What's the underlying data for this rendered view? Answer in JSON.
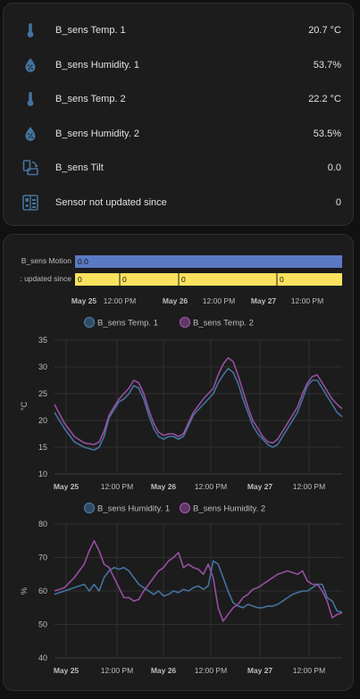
{
  "colors": {
    "background": "#111111",
    "card": "#1c1c1c",
    "icon": "#44739e",
    "series_blue": "#44739e",
    "series_purple": "#984ea3",
    "timeline_motion": "#5b7ac4",
    "timeline_updated": "#fbe25e"
  },
  "entities": [
    {
      "icon": "thermometer-icon",
      "label": "B_sens Temp. 1",
      "value": "20.7 °C"
    },
    {
      "icon": "water-percent-icon",
      "label": "B_sens Humidity. 1",
      "value": "53.7%"
    },
    {
      "icon": "thermometer-icon",
      "label": "B_sens Temp. 2",
      "value": "22.2 °C"
    },
    {
      "icon": "water-percent-icon",
      "label": "B_sens Humidity. 2",
      "value": "53.5%"
    },
    {
      "icon": "phone-rotate-icon",
      "label": "B_sens Tilt",
      "value": "0.0"
    },
    {
      "icon": "motion-sensor-icon",
      "label": "Sensor not updated since",
      "value": "0"
    }
  ],
  "timeline": {
    "rows": [
      {
        "label": "B_sens Motion",
        "segments": [
          "0.0"
        ]
      },
      {
        "label": ": updated since",
        "segments": [
          "0",
          "0",
          "0",
          "0"
        ]
      }
    ],
    "x_ticks": [
      "May 25",
      "12:00 PM",
      "May 26",
      "12:00 PM",
      "May 27",
      "12:00 PM"
    ]
  },
  "chart_data": [
    {
      "type": "line",
      "legend": [
        "B_sens Temp. 1",
        "B_sens Temp. 2"
      ],
      "ylabel": "°C",
      "ylim": [
        10,
        35
      ],
      "yticks": [
        10,
        15,
        20,
        25,
        30,
        35
      ],
      "x_ticks": [
        "May 25",
        "12:00 PM",
        "May 26",
        "12:00 PM",
        "May 27",
        "12:00 PM"
      ],
      "x_range_hours": [
        0,
        60
      ],
      "series": [
        {
          "name": "B_sens Temp. 1",
          "color": "#44739e",
          "points": [
            [
              0,
              21.5
            ],
            [
              2,
              18.5
            ],
            [
              4,
              16
            ],
            [
              6,
              15
            ],
            [
              8,
              14.5
            ],
            [
              9,
              15
            ],
            [
              10,
              17
            ],
            [
              11,
              20.5
            ],
            [
              12,
              22
            ],
            [
              13,
              23.5
            ],
            [
              14,
              24
            ],
            [
              15,
              25
            ],
            [
              16,
              26.5
            ],
            [
              17,
              26
            ],
            [
              18,
              24
            ],
            [
              19,
              21
            ],
            [
              20,
              18.5
            ],
            [
              21,
              17
            ],
            [
              22,
              16.5
            ],
            [
              23,
              17
            ],
            [
              24,
              17
            ],
            [
              25,
              16.5
            ],
            [
              26,
              17
            ],
            [
              27,
              19
            ],
            [
              28,
              21
            ],
            [
              30,
              23
            ],
            [
              32,
              25
            ],
            [
              33,
              27
            ],
            [
              34,
              28.5
            ],
            [
              35,
              29.7
            ],
            [
              36,
              29
            ],
            [
              37,
              27
            ],
            [
              38,
              24
            ],
            [
              39,
              21.5
            ],
            [
              40,
              19
            ],
            [
              41,
              17.5
            ],
            [
              42,
              16.5
            ],
            [
              43,
              15.5
            ],
            [
              44,
              15
            ],
            [
              45,
              15.5
            ],
            [
              46,
              17
            ],
            [
              47,
              18.5
            ],
            [
              48,
              20
            ],
            [
              49,
              21.5
            ],
            [
              50,
              24
            ],
            [
              51,
              26.5
            ],
            [
              52,
              27.5
            ],
            [
              53,
              27.5
            ],
            [
              54,
              26
            ],
            [
              55,
              24.5
            ],
            [
              56,
              23
            ],
            [
              57,
              21.5
            ],
            [
              58,
              20.7
            ]
          ]
        },
        {
          "name": "B_sens Temp. 2",
          "color": "#984ea3",
          "points": [
            [
              0,
              23
            ],
            [
              2,
              19.5
            ],
            [
              4,
              17
            ],
            [
              6,
              15.8
            ],
            [
              8,
              15.5
            ],
            [
              9,
              16
            ],
            [
              10,
              18
            ],
            [
              11,
              21
            ],
            [
              12,
              22.5
            ],
            [
              13,
              24
            ],
            [
              14,
              25
            ],
            [
              15,
              26
            ],
            [
              16,
              27.5
            ],
            [
              17,
              27
            ],
            [
              18,
              25
            ],
            [
              19,
              22
            ],
            [
              20,
              19.5
            ],
            [
              21,
              17.8
            ],
            [
              22,
              17.2
            ],
            [
              23,
              17.5
            ],
            [
              24,
              17.5
            ],
            [
              25,
              17
            ],
            [
              26,
              17.5
            ],
            [
              27,
              19.5
            ],
            [
              28,
              21.5
            ],
            [
              30,
              24
            ],
            [
              32,
              26
            ],
            [
              33,
              28.5
            ],
            [
              34,
              30.5
            ],
            [
              35,
              31.7
            ],
            [
              36,
              31
            ],
            [
              37,
              28.5
            ],
            [
              38,
              25.5
            ],
            [
              39,
              22.5
            ],
            [
              40,
              20
            ],
            [
              41,
              18.5
            ],
            [
              42,
              17
            ],
            [
              43,
              16
            ],
            [
              44,
              15.8
            ],
            [
              45,
              16.5
            ],
            [
              46,
              18
            ],
            [
              47,
              19.5
            ],
            [
              48,
              21
            ],
            [
              49,
              22.5
            ],
            [
              50,
              25
            ],
            [
              51,
              27
            ],
            [
              52,
              28.2
            ],
            [
              53,
              28.5
            ],
            [
              54,
              27
            ],
            [
              55,
              25.5
            ],
            [
              56,
              24
            ],
            [
              57,
              23
            ],
            [
              58,
              22.2
            ]
          ]
        }
      ]
    },
    {
      "type": "line",
      "legend": [
        "B_sens Humidity. 1",
        "B_sens Humidity. 2"
      ],
      "ylabel": "%",
      "ylim": [
        40,
        80
      ],
      "yticks": [
        40,
        50,
        60,
        70,
        80
      ],
      "x_ticks": [
        "May 25",
        "12:00 PM",
        "May 26",
        "12:00 PM",
        "May 27",
        "12:00 PM"
      ],
      "x_range_hours": [
        0,
        60
      ],
      "series": [
        {
          "name": "B_sens Humidity. 1",
          "color": "#44739e",
          "points": [
            [
              0,
              59
            ],
            [
              2,
              60
            ],
            [
              4,
              61
            ],
            [
              6,
              62
            ],
            [
              7,
              60
            ],
            [
              8,
              62
            ],
            [
              9,
              60
            ],
            [
              10,
              64
            ],
            [
              11,
              66
            ],
            [
              12,
              67
            ],
            [
              13,
              66.5
            ],
            [
              14,
              67
            ],
            [
              15,
              66
            ],
            [
              16,
              64
            ],
            [
              17,
              62
            ],
            [
              18,
              61
            ],
            [
              19,
              60
            ],
            [
              20,
              59
            ],
            [
              21,
              60
            ],
            [
              22,
              58.5
            ],
            [
              23,
              59
            ],
            [
              24,
              60
            ],
            [
              25,
              59.5
            ],
            [
              26,
              60.5
            ],
            [
              27,
              60
            ],
            [
              28,
              61
            ],
            [
              29,
              61.5
            ],
            [
              30,
              60.5
            ],
            [
              31,
              61.5
            ],
            [
              32,
              69
            ],
            [
              33,
              68
            ],
            [
              34,
              64
            ],
            [
              35,
              60
            ],
            [
              36,
              56.5
            ],
            [
              37,
              55.5
            ],
            [
              38,
              55
            ],
            [
              39,
              56
            ],
            [
              40,
              55.5
            ],
            [
              41,
              55
            ],
            [
              42,
              55
            ],
            [
              43,
              55.5
            ],
            [
              44,
              55.5
            ],
            [
              45,
              56
            ],
            [
              46,
              57
            ],
            [
              47,
              58
            ],
            [
              48,
              59
            ],
            [
              49,
              59.5
            ],
            [
              50,
              60
            ],
            [
              51,
              60
            ],
            [
              52,
              61
            ],
            [
              53,
              62
            ],
            [
              54,
              62
            ],
            [
              55,
              58
            ],
            [
              56,
              57
            ],
            [
              57,
              54
            ],
            [
              58,
              53.7
            ]
          ]
        },
        {
          "name": "B_sens Humidity. 2",
          "color": "#984ea3",
          "points": [
            [
              0,
              60
            ],
            [
              2,
              61
            ],
            [
              4,
              64
            ],
            [
              6,
              68
            ],
            [
              7,
              72
            ],
            [
              8,
              75
            ],
            [
              9,
              72
            ],
            [
              10,
              68
            ],
            [
              11,
              67
            ],
            [
              12,
              64
            ],
            [
              13,
              61
            ],
            [
              14,
              58
            ],
            [
              15,
              58
            ],
            [
              16,
              57
            ],
            [
              17,
              57.5
            ],
            [
              18,
              60
            ],
            [
              19,
              62
            ],
            [
              20,
              64
            ],
            [
              21,
              66
            ],
            [
              22,
              67
            ],
            [
              23,
              69
            ],
            [
              24,
              70
            ],
            [
              25,
              71.5
            ],
            [
              26,
              67
            ],
            [
              27,
              68
            ],
            [
              28,
              67
            ],
            [
              29,
              66.5
            ],
            [
              30,
              65
            ],
            [
              31,
              68
            ],
            [
              32,
              64
            ],
            [
              33,
              55
            ],
            [
              34,
              51
            ],
            [
              35,
              53
            ],
            [
              36,
              55
            ],
            [
              37,
              56
            ],
            [
              38,
              58
            ],
            [
              39,
              59
            ],
            [
              40,
              60.5
            ],
            [
              41,
              61
            ],
            [
              42,
              62
            ],
            [
              43,
              63
            ],
            [
              44,
              64
            ],
            [
              45,
              65
            ],
            [
              46,
              65.5
            ],
            [
              47,
              66
            ],
            [
              48,
              65.5
            ],
            [
              49,
              65
            ],
            [
              50,
              66
            ],
            [
              51,
              63
            ],
            [
              52,
              62
            ],
            [
              53,
              62
            ],
            [
              54,
              60
            ],
            [
              55,
              57
            ],
            [
              56,
              52
            ],
            [
              57,
              53
            ],
            [
              58,
              53.5
            ]
          ]
        }
      ]
    }
  ]
}
